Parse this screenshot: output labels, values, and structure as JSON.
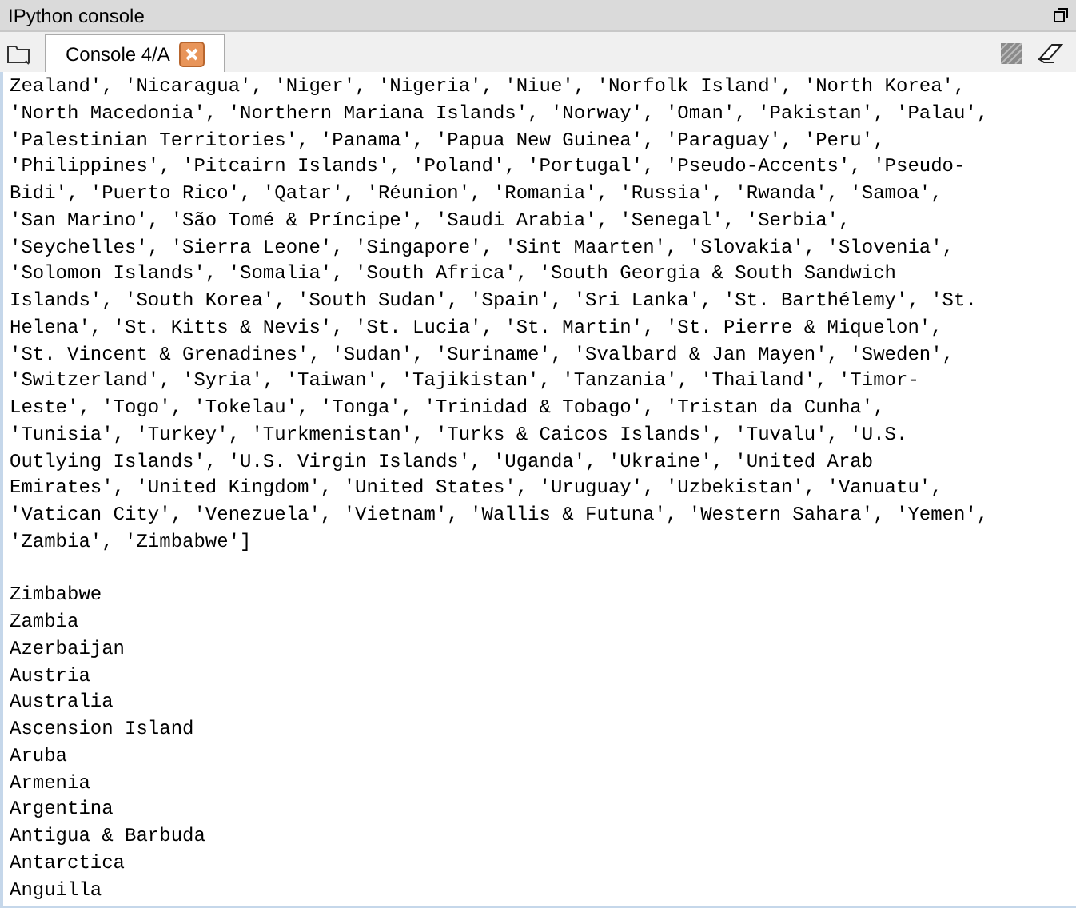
{
  "pane": {
    "title": "IPython console"
  },
  "tabs": [
    {
      "label": "Console 4/A",
      "selected": true
    }
  ],
  "console": {
    "list_output": [
      "Zealand', 'Nicaragua', 'Niger', 'Nigeria', 'Niue', 'Norfolk Island', 'North Korea',",
      "'North Macedonia', 'Northern Mariana Islands', 'Norway', 'Oman', 'Pakistan', 'Palau',",
      "'Palestinian Territories', 'Panama', 'Papua New Guinea', 'Paraguay', 'Peru',",
      "'Philippines', 'Pitcairn Islands', 'Poland', 'Portugal', 'Pseudo-Accents', 'Pseudo-",
      "Bidi', 'Puerto Rico', 'Qatar', 'Réunion', 'Romania', 'Russia', 'Rwanda', 'Samoa',",
      "'San Marino', 'São Tomé & Príncipe', 'Saudi Arabia', 'Senegal', 'Serbia',",
      "'Seychelles', 'Sierra Leone', 'Singapore', 'Sint Maarten', 'Slovakia', 'Slovenia',",
      "'Solomon Islands', 'Somalia', 'South Africa', 'South Georgia & South Sandwich",
      "Islands', 'South Korea', 'South Sudan', 'Spain', 'Sri Lanka', 'St. Barthélemy', 'St.",
      "Helena', 'St. Kitts & Nevis', 'St. Lucia', 'St. Martin', 'St. Pierre & Miquelon',",
      "'St. Vincent & Grenadines', 'Sudan', 'Suriname', 'Svalbard & Jan Mayen', 'Sweden',",
      "'Switzerland', 'Syria', 'Taiwan', 'Tajikistan', 'Tanzania', 'Thailand', 'Timor-",
      "Leste', 'Togo', 'Tokelau', 'Tonga', 'Trinidad & Tobago', 'Tristan da Cunha',",
      "'Tunisia', 'Turkey', 'Turkmenistan', 'Turks & Caicos Islands', 'Tuvalu', 'U.S.",
      "Outlying Islands', 'U.S. Virgin Islands', 'Uganda', 'Ukraine', 'United Arab",
      "Emirates', 'United Kingdom', 'United States', 'Uruguay', 'Uzbekistan', 'Vanuatu',",
      "'Vatican City', 'Venezuela', 'Vietnam', 'Wallis & Futuna', 'Western Sahara', 'Yemen',",
      "'Zambia', 'Zimbabwe']"
    ],
    "printed_lines": [
      "Zimbabwe",
      "Zambia",
      "Azerbaijan",
      "Austria",
      "Australia",
      "Ascension Island",
      "Aruba",
      "Armenia",
      "Argentina",
      "Antigua & Barbuda",
      "Antarctica",
      "Anguilla"
    ]
  }
}
